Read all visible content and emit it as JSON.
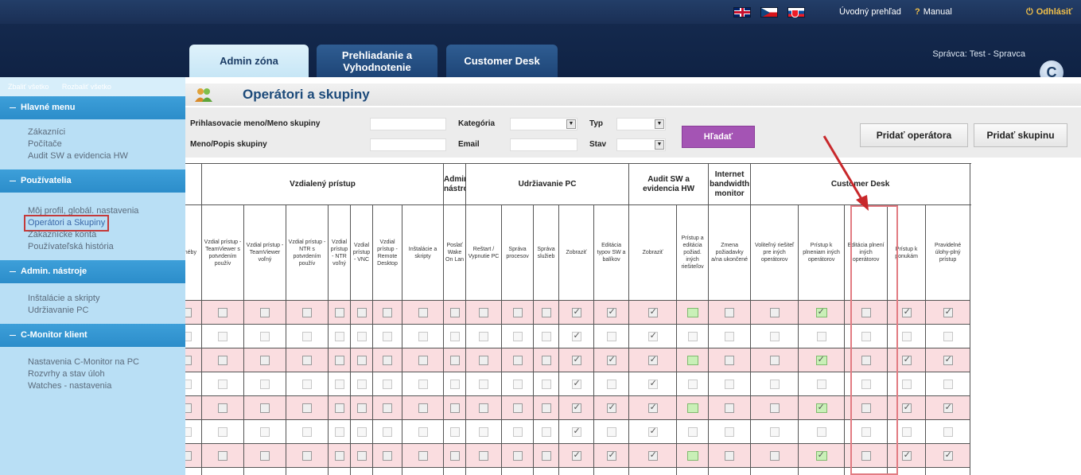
{
  "topbar": {
    "flags": [
      "uk-flag-icon",
      "cz-flag-icon",
      "sk-flag-icon"
    ],
    "overview_link": "Úvodný prehľad",
    "manual_link": "Manual",
    "manual_icon": "?",
    "logout_link": "Odhlásiť",
    "logout_icon": "power-icon"
  },
  "tabs": [
    {
      "label": "Admin zóna",
      "active": true
    },
    {
      "label": "Prehliadanie a Vyhodnotenie",
      "active": false
    },
    {
      "label": "Customer Desk",
      "active": false
    }
  ],
  "admin_label": "Správca: Test - Spravca",
  "logo_letter": "C",
  "sidebar": {
    "collapse_all": "Zbaliť všetko",
    "expand_all": "Rozbaliť všetko",
    "sections": [
      {
        "title": "Hlavné menu",
        "items": [
          "Zákazníci",
          "Počítače",
          "Audit SW a evidencia HW"
        ]
      },
      {
        "title": "Používatelia",
        "items": [
          "Môj profil, globál. nastavenia",
          "Operátori a Skupiny",
          "Zákaznícke kontá",
          "Používateľská história"
        ]
      },
      {
        "title": "Admin. nástroje",
        "items": [
          "Inštalácie a skripty",
          "Udržiavanie PC"
        ]
      },
      {
        "title": "C-Monitor klient",
        "items": [
          "Nastavenia C-Monitor na PC",
          "Rozvrhy a stav úloh",
          "Watches - nastavenia"
        ]
      }
    ]
  },
  "page_title": "Operátori a skupiny",
  "filters": {
    "login_label": "Prihlasovacie meno/Meno skupiny",
    "name_label": "Meno/Popis skupiny",
    "category_label": "Kategória",
    "email_label": "Email",
    "type_label": "Typ",
    "state_label": "Stav",
    "search_button": "Hľadať",
    "add_operator_button": "Pridať operátora",
    "add_group_button": "Pridať skupinu"
  },
  "table": {
    "groups": [
      {
        "label": "",
        "span": 1
      },
      {
        "label": "Vzdialený prístup",
        "span": 7
      },
      {
        "label": "Admin nástroje",
        "span": 1
      },
      {
        "label": "Udržiavanie PC",
        "span": 5
      },
      {
        "label": "Audit SW a evidencia HW",
        "span": 2
      },
      {
        "label": "Internet bandwidth monitor",
        "span": 1
      },
      {
        "label": "Customer Desk",
        "span": 7
      }
    ],
    "columns": [
      "menéby",
      "Vzdial prístup - TeamViewer s potvrdením použív",
      "Vzdial prístup - TeamViewer voľný",
      "Vzdial prístup - NTR s potvrdením použív",
      "Vzdial prístup - NTR voľný",
      "Vzdial prístup - VNC",
      "Vzdial prístup - Remote Desktop",
      "Inštalácie a skripty",
      "Poslať Wake On Lan",
      "Reštart / Vypnutie PC",
      "Správa procesov",
      "Správa služieb",
      "Zobraziť",
      "Editácia typov SW a balíkov",
      "Zobraziť",
      "Prístup a editácia požiad. iných riešiteľov",
      "Zmena požiadavky a/na ukončené",
      "Voliteľný riešiteľ pre iných operátorov",
      "Prístup k plneniam iných operátorov",
      "Editácia plnení iných operátorov",
      "Prístup k ponukám",
      "Pravidelné úlohy-plný prístup"
    ],
    "rows": [
      {
        "style": "pink",
        "cells": [
          0,
          0,
          0,
          0,
          0,
          0,
          0,
          0,
          0,
          0,
          0,
          0,
          1,
          1,
          1,
          2,
          0,
          0,
          3,
          0,
          1,
          1
        ]
      },
      {
        "style": "white",
        "cells": [
          0,
          0,
          0,
          0,
          0,
          0,
          0,
          0,
          0,
          0,
          0,
          0,
          1,
          0,
          1,
          0,
          0,
          0,
          0,
          0,
          0,
          0
        ]
      },
      {
        "style": "pink",
        "cells": [
          0,
          0,
          0,
          0,
          0,
          0,
          0,
          0,
          0,
          0,
          0,
          0,
          1,
          1,
          1,
          2,
          0,
          0,
          3,
          0,
          1,
          1
        ]
      },
      {
        "style": "white",
        "cells": [
          0,
          0,
          0,
          0,
          0,
          0,
          0,
          0,
          0,
          0,
          0,
          0,
          1,
          0,
          1,
          0,
          0,
          0,
          0,
          0,
          0,
          0
        ]
      },
      {
        "style": "pink",
        "cells": [
          0,
          0,
          0,
          0,
          0,
          0,
          0,
          0,
          0,
          0,
          0,
          0,
          1,
          1,
          1,
          2,
          0,
          0,
          3,
          0,
          1,
          1
        ]
      },
      {
        "style": "white",
        "cells": [
          0,
          0,
          0,
          0,
          0,
          0,
          0,
          0,
          0,
          0,
          0,
          0,
          1,
          0,
          1,
          0,
          0,
          0,
          0,
          0,
          0,
          0
        ]
      },
      {
        "style": "pink",
        "cells": [
          0,
          0,
          0,
          0,
          0,
          0,
          0,
          0,
          0,
          0,
          0,
          0,
          1,
          1,
          1,
          2,
          0,
          0,
          3,
          0,
          1,
          1
        ]
      },
      {
        "style": "white",
        "cells": [
          0,
          0,
          0,
          0,
          0,
          0,
          0,
          0,
          0,
          0,
          0,
          0,
          1,
          0,
          1,
          0,
          0,
          0,
          0,
          0,
          0,
          0
        ]
      }
    ]
  },
  "colors": {
    "accent": "#a454b4",
    "highlight": "#e27b82",
    "row_pink": "#fadde0",
    "sidebar_head": "#3d9fd9"
  }
}
